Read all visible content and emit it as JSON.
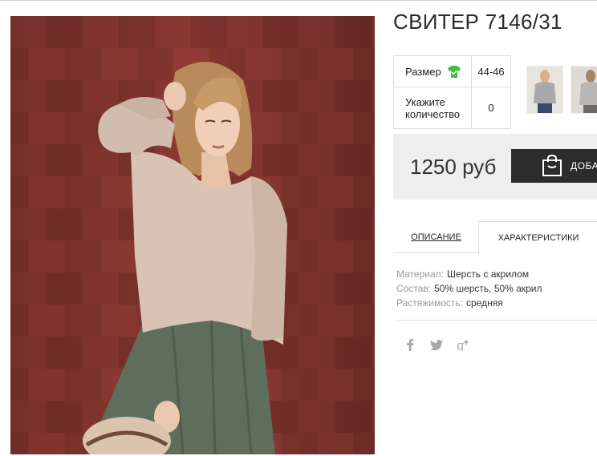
{
  "product": {
    "title": "СВИТЕР 7146/31",
    "main_image_icon": "model-in-sweater-photo"
  },
  "options": {
    "size_label": "Размер",
    "size_icon": "tshirt-check-icon",
    "size_value": "44-46",
    "quantity_label_line1": "Укажите",
    "quantity_label_line2": "количество",
    "quantity_value": "0"
  },
  "thumbnails": [
    {
      "icon": "product-thumbnail"
    },
    {
      "icon": "product-thumbnail"
    }
  ],
  "price": {
    "text": "1250 руб",
    "buy_label": "ДОБАВ",
    "buy_icon": "shopping-bag-icon"
  },
  "tabs": [
    {
      "label": "ОПИСАНИЕ",
      "active": false
    },
    {
      "label": "ХАРАКТЕРИСТИКИ",
      "active": true
    }
  ],
  "specs": [
    {
      "key": "Материал:",
      "value": "Шерсть с акрилом"
    },
    {
      "key": "Состав:",
      "value": "50% шерсть, 50% акрил"
    },
    {
      "key": "Растяжимость:",
      "value": "средняя"
    }
  ],
  "social": [
    {
      "icon": "facebook-icon",
      "glyph": "f"
    },
    {
      "icon": "twitter-icon",
      "glyph": ""
    },
    {
      "icon": "google-plus-icon",
      "glyph": "g+"
    }
  ],
  "colors": {
    "accent_green": "#3fbf3f",
    "button_dark": "#2c2c2c",
    "price_bg": "#eeeeee",
    "roof_tile": "#7a302c"
  }
}
